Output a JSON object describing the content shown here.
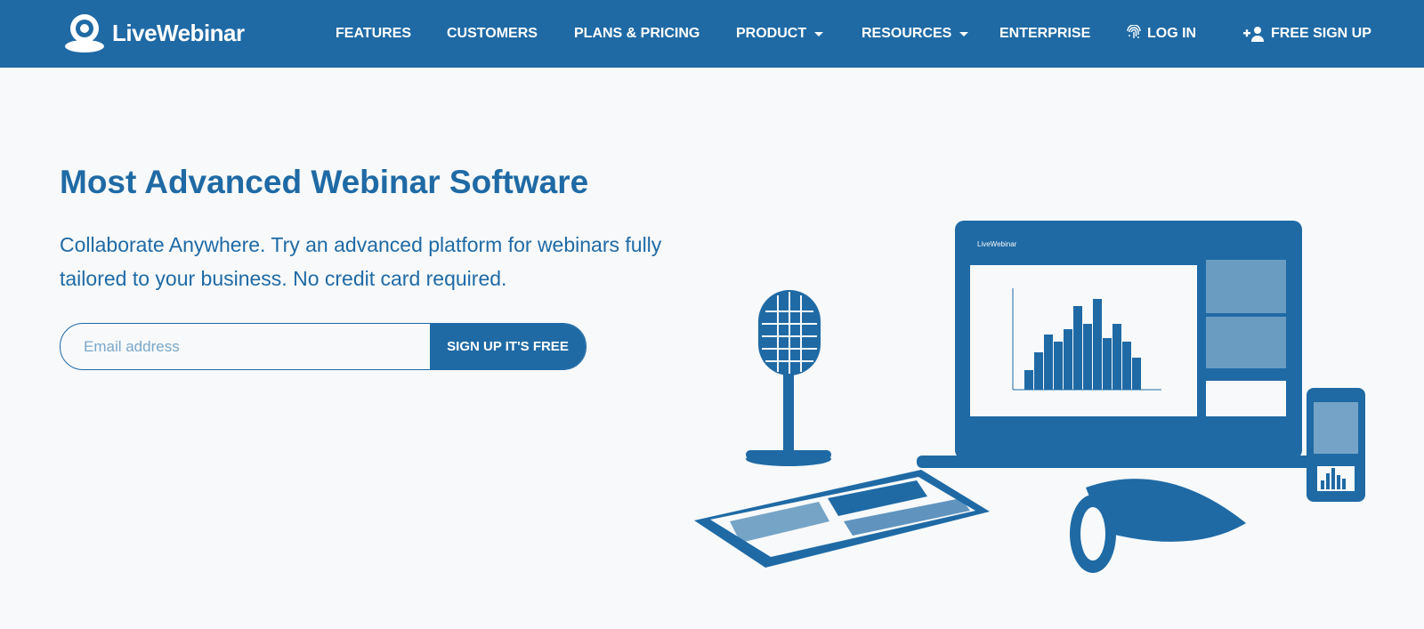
{
  "brand": {
    "name": "LiveWebinar"
  },
  "nav": {
    "items": [
      {
        "label": "FEATURES"
      },
      {
        "label": "CUSTOMERS"
      },
      {
        "label": "PLANS & PRICING"
      },
      {
        "label": "PRODUCT"
      },
      {
        "label": "RESOURCES"
      },
      {
        "label": "ENTERPRISE"
      }
    ],
    "login_label": "LOG IN",
    "signup_label": "FREE SIGN UP"
  },
  "hero": {
    "title": "Most Advanced Webinar Software",
    "subtitle": "Collaborate Anywhere. Try an advanced platform for webinars fully tailored to your business. No credit card required.",
    "email_placeholder": "Email address",
    "email_value": "",
    "cta_label": "SIGN UP IT'S FREE"
  },
  "colors": {
    "brand": "#1f6aa5",
    "background": "#f7f9fa",
    "text_on_brand": "#ffffff"
  },
  "icons": [
    "logo-icon",
    "chevron-down-icon",
    "fingerprint-icon",
    "add-user-icon"
  ]
}
